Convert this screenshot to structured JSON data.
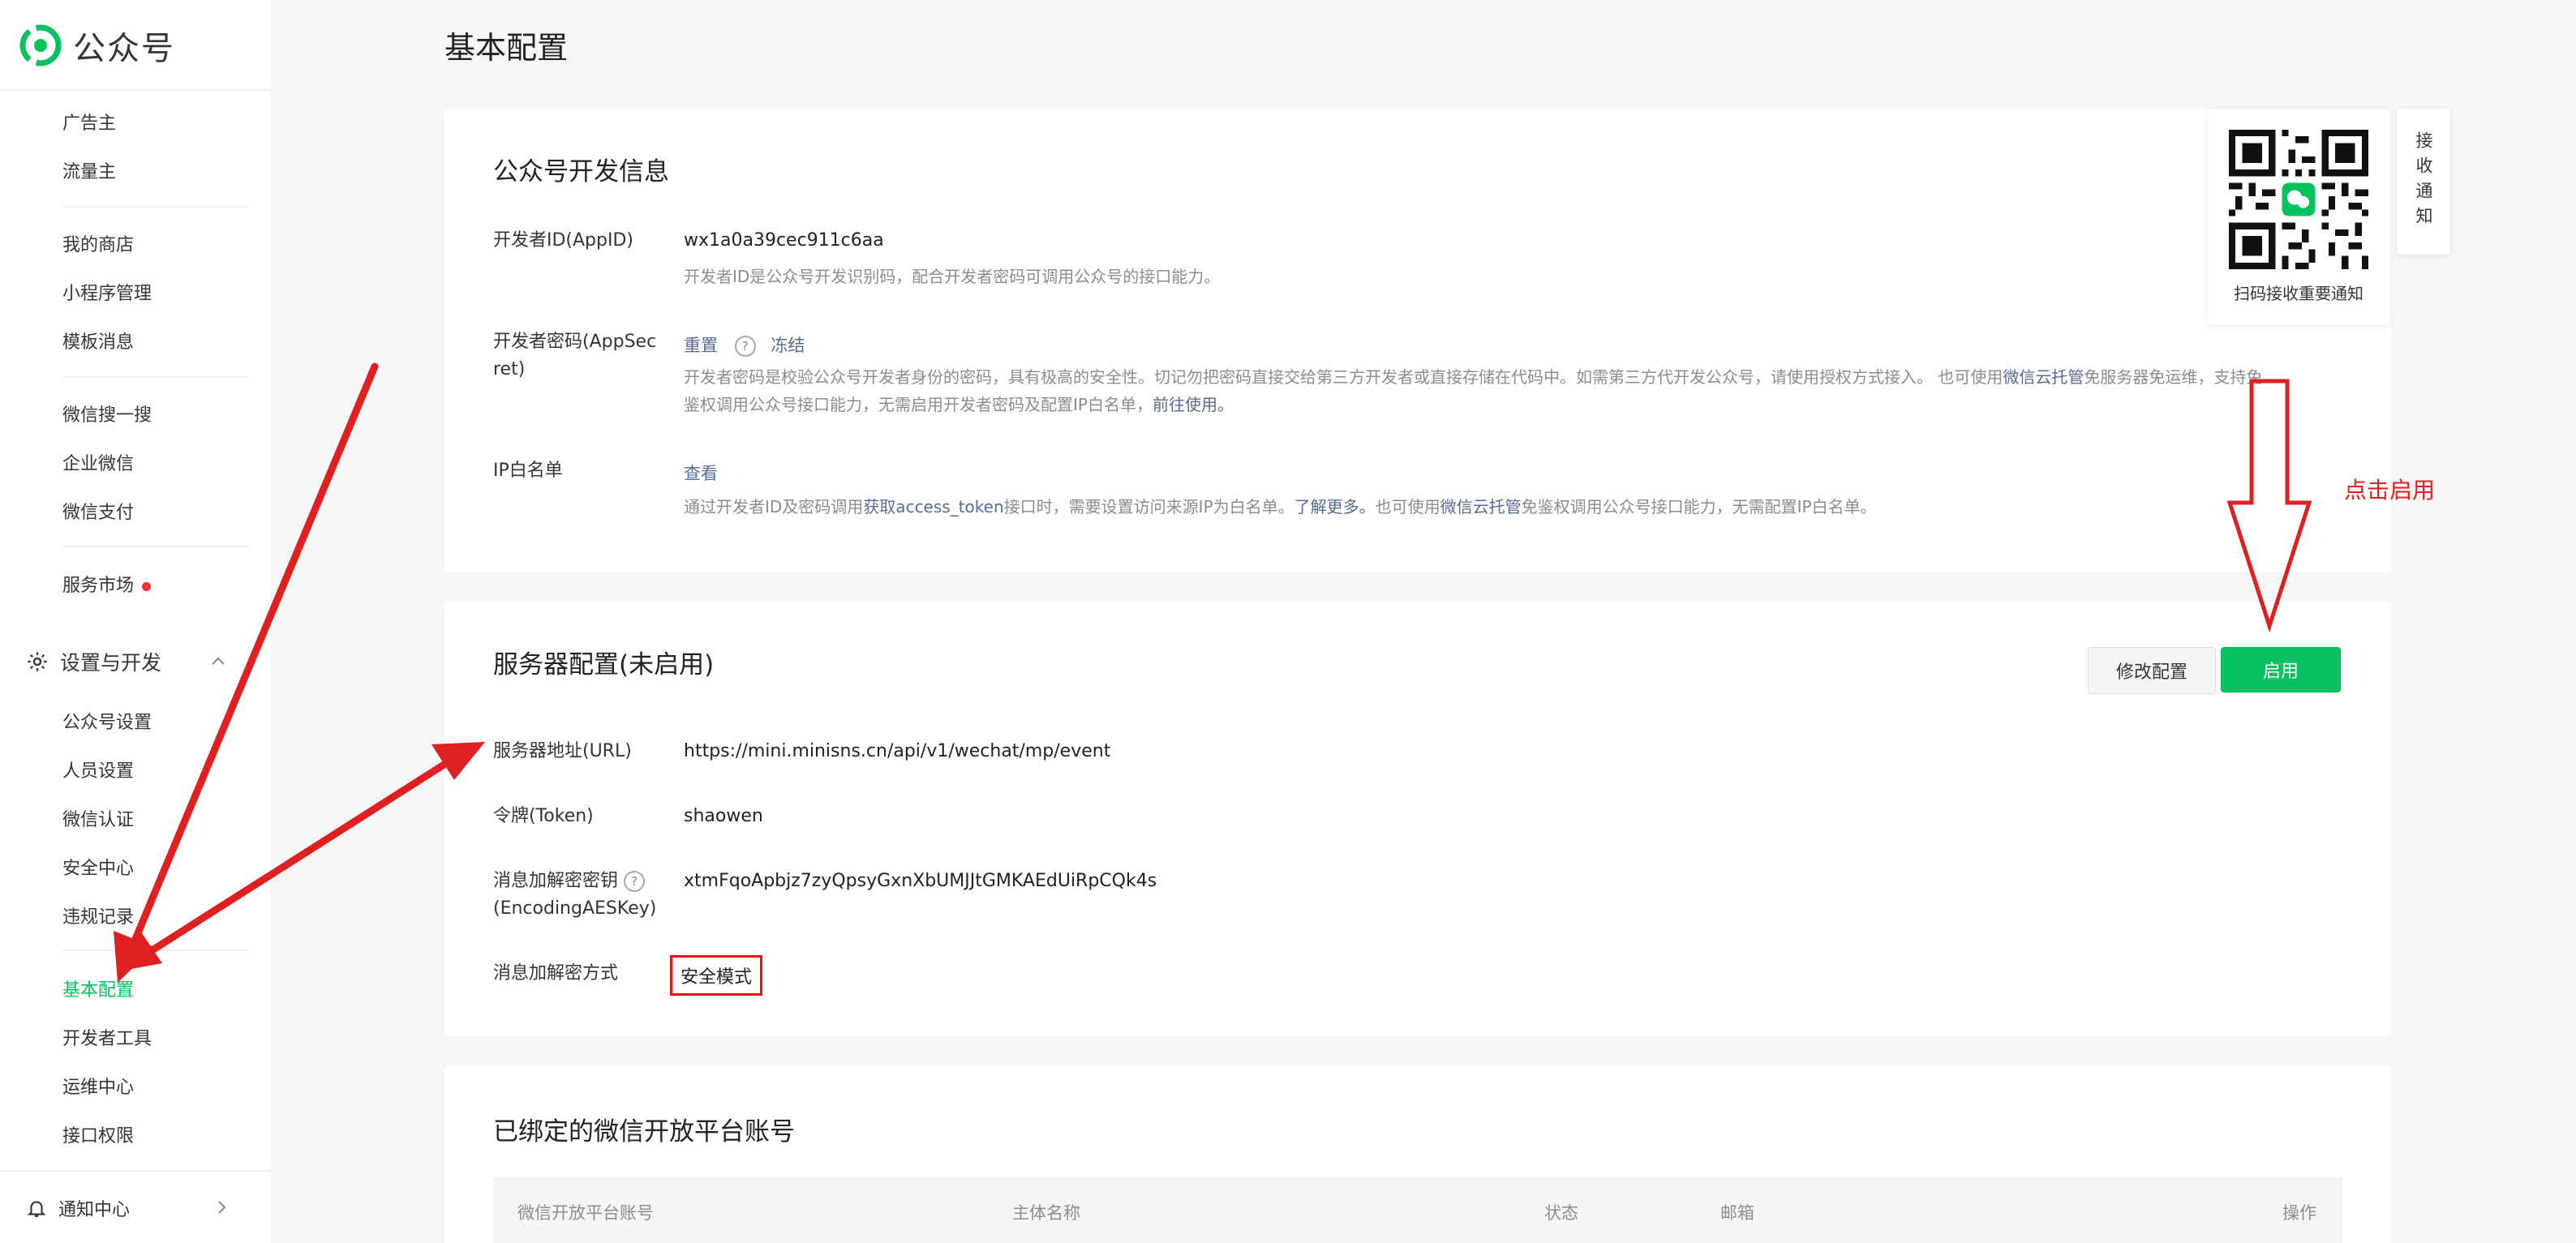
{
  "app": {
    "name": "公众号",
    "brand_color": "#07c160"
  },
  "sidebar": {
    "items_top": [
      "广告主",
      "流量主",
      "我的商店",
      "小程序管理",
      "模板消息",
      "微信搜一搜",
      "企业微信",
      "微信支付",
      "服务市场"
    ],
    "section": {
      "label": "设置与开发",
      "icon": "gear-icon",
      "expanded": true
    },
    "section_items": [
      "公众号设置",
      "人员设置",
      "微信认证",
      "安全中心",
      "违规记录",
      "基本配置",
      "开发者工具",
      "运维中心",
      "接口权限"
    ],
    "active_item": "基本配置",
    "notify": {
      "label": "通知中心",
      "icon": "bell-icon"
    }
  },
  "page": {
    "title": "基本配置"
  },
  "dev_info": {
    "title": "公众号开发信息",
    "appid_label": "开发者ID(AppID)",
    "appid_value": "wx1a0a39cec911c6aa",
    "appid_desc": "开发者ID是公众号开发识别码，配合开发者密码可调用公众号的接口能力。",
    "secret_label_1": "开发者密码(AppSec",
    "secret_label_2": "ret)",
    "reset_link": "重置",
    "freeze_link": "冻结",
    "secret_desc_1": "开发者密码是校验公众号开发者身份的密码，具有极高的安全性。切记勿把密码直接交给第三方开发者或直接存储在代码中。如需第三方代开发公众号，请使用授权方式接入。 也可使用",
    "secret_desc_link1": "微信云托管",
    "secret_desc_2": "免服务器免运维，支持免",
    "secret_desc_3": "鉴权调用公众号接口能力，无需启用开发者密码及配置IP白名单，",
    "secret_desc_link2": "前往使用。",
    "ip_label": "IP白名单",
    "ip_view_link": "查看",
    "ip_desc_1": "通过开发者ID及密码调用",
    "ip_desc_link1": "获取access_token",
    "ip_desc_2": "接口时，需要设置访问来源IP为白名单。",
    "ip_desc_link2": "了解更多。",
    "ip_desc_3": "也可使用",
    "ip_desc_link3": "微信云托管",
    "ip_desc_4": "免鉴权调用公众号接口能力，无需配置IP白名单。"
  },
  "server_config": {
    "title": "服务器配置(未启用)",
    "modify_button": "修改配置",
    "enable_button": "启用",
    "url_label": "服务器地址(URL)",
    "url_value": "https://mini.minisns.cn/api/v1/wechat/mp/event",
    "token_label": "令牌(Token)",
    "token_value": "shaowen",
    "aes_label_1": "消息加解密密钥",
    "aes_label_2": "(EncodingAESKey)",
    "aes_value": "xtmFqoApbjz7zyQpsyGxnXbUMJJtGMKAEdUiRpCQk4s",
    "mode_label": "消息加解密方式",
    "mode_value": "安全模式"
  },
  "bound_accounts": {
    "title": "已绑定的微信开放平台账号",
    "columns": [
      "微信开放平台账号",
      "主体名称",
      "状态",
      "邮箱",
      "操作"
    ]
  },
  "qr_panel": {
    "caption": "扫码接收重要通知",
    "tab_label": "接收通知"
  },
  "annotation": {
    "text": "点击启用",
    "color": "#e02020"
  }
}
